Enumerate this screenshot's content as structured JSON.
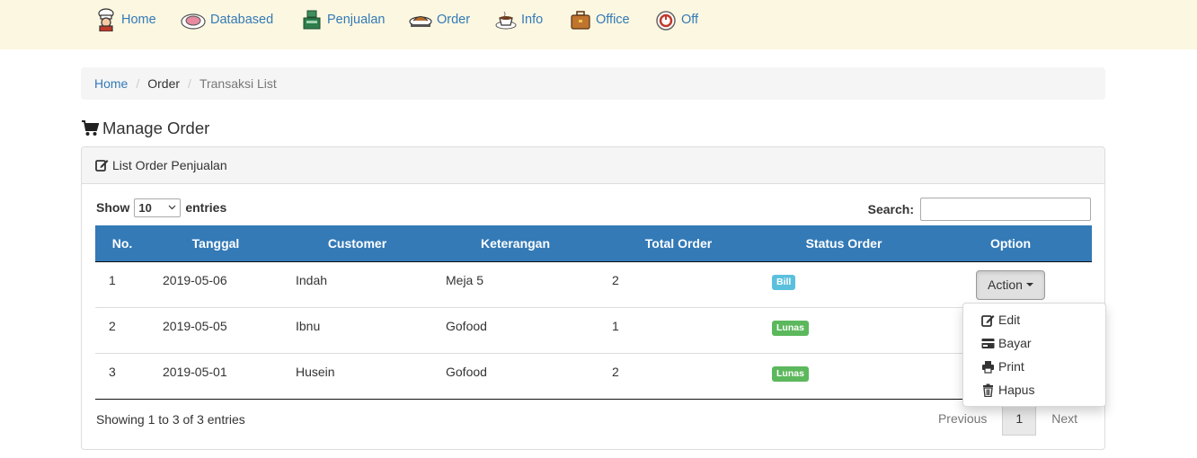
{
  "nav": {
    "items": [
      {
        "label": "Home",
        "icon": "chef-icon"
      },
      {
        "label": "Databased",
        "icon": "plate-icon"
      },
      {
        "label": "Penjualan",
        "icon": "cash-register-icon"
      },
      {
        "label": "Order",
        "icon": "food-tray-icon"
      },
      {
        "label": "Info",
        "icon": "coffee-cup-icon"
      },
      {
        "label": "Office",
        "icon": "briefcase-icon"
      },
      {
        "label": "Off",
        "icon": "power-icon"
      }
    ]
  },
  "breadcrumb": {
    "items": [
      "Home",
      "Order",
      "Transaksi List"
    ],
    "separator": "/"
  },
  "page": {
    "title": "Manage Order",
    "title_icon": "shopping-cart-icon"
  },
  "panel": {
    "heading": "List Order Penjualan",
    "heading_icon": "edit-icon"
  },
  "controls": {
    "show_label": "Show",
    "page_size": "10",
    "entries_label": "entries",
    "search_label": "Search:",
    "search_value": ""
  },
  "table": {
    "columns": [
      "No.",
      "Tanggal",
      "Customer",
      "Keterangan",
      "Total Order",
      "Status Order",
      "Option"
    ],
    "rows": [
      {
        "no": "1",
        "tanggal": "2019-05-06",
        "customer": "Indah",
        "keterangan": "Meja 5",
        "total": "2",
        "status": "Bill",
        "status_color": "#5bc0de"
      },
      {
        "no": "2",
        "tanggal": "2019-05-05",
        "customer": "Ibnu",
        "keterangan": "Gofood",
        "total": "1",
        "status": "Lunas",
        "status_color": "#5cb85c"
      },
      {
        "no": "3",
        "tanggal": "2019-05-01",
        "customer": "Husein",
        "keterangan": "Gofood",
        "total": "2",
        "status": "Lunas",
        "status_color": "#5cb85c"
      }
    ],
    "action_label": "Action"
  },
  "dropdown": {
    "items": [
      {
        "label": "Edit",
        "icon": "edit-icon"
      },
      {
        "label": "Bayar",
        "icon": "credit-card-icon"
      },
      {
        "label": "Print",
        "icon": "print-icon"
      },
      {
        "label": "Hapus",
        "icon": "trash-icon"
      }
    ]
  },
  "footer": {
    "info": "Showing 1 to 3 of 3 entries",
    "previous": "Previous",
    "current_page": "1",
    "next": "Next"
  },
  "colors": {
    "navbar_bg": "#fcf7e1",
    "link": "#337ab7",
    "table_header": "#337ab7",
    "bill_badge": "#5bc0de",
    "lunas_badge": "#5cb85c"
  }
}
